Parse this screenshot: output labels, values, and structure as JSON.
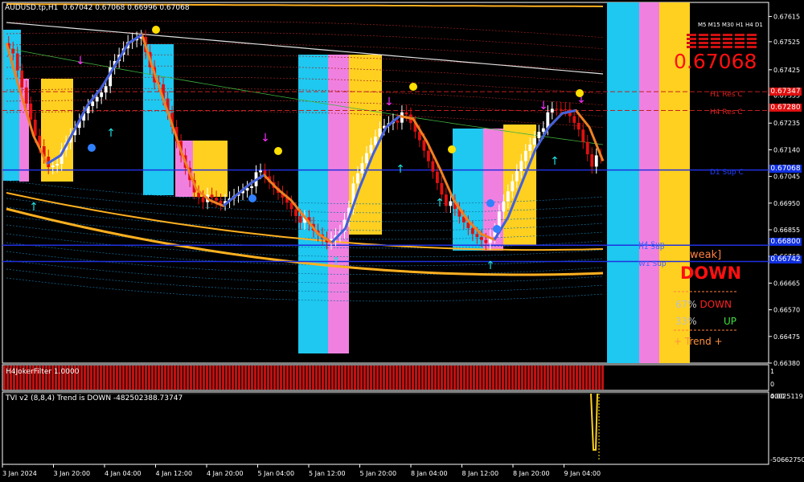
{
  "header": {
    "symbol": "AUDUSD.tp,H1",
    "ohlc": "0.67042 0.67068 0.66996 0.67068"
  },
  "timeframes": [
    "M5",
    "M15",
    "M30",
    "H1",
    "H4",
    "D1"
  ],
  "big_price": "0.67068",
  "levels": {
    "h1_res": "H1 Res C",
    "h4_res": "H4 Res C",
    "d1_sup": "D1 Sup C",
    "h1_sup": "H1 Sup",
    "w1_sup": "W1 Sup",
    "h4_sup_overlap": "H4 Sup"
  },
  "price_tags": [
    "0.67347",
    "0.67280",
    "0.67068",
    "0.66800",
    "0.66742"
  ],
  "panel": {
    "strength": "weak]",
    "signal": "DOWN",
    "down_pct": "67%",
    "down_word": "DOWN",
    "up_pct": "33%",
    "up_word": "UP",
    "trend": "+  Trend  +"
  },
  "indicators": {
    "joker_title": "H4JokerFilter 1.0000",
    "joker_scale": [
      "1",
      "0"
    ],
    "tvi_title": "TVI v2 (8,8,4) Trend is DOWN -482502388.73747",
    "tvi_scale_top": "40025119",
    "tvi_scale_mid": "0.00",
    "tvi_scale_bottom": "-506627502"
  },
  "colors": {
    "bull": "#ffffff",
    "bear": "#e01010",
    "cyan": "#1ec8f0",
    "pink": "#f080e0",
    "yellow": "#ffd020",
    "blue_line": "#4060e0",
    "orange_line": "#f08020",
    "band_orange": "#ffb020"
  },
  "chart_data": {
    "type": "candlestick",
    "symbol": "AUDUSD.tp",
    "timeframe": "H1",
    "y_ticks": [
      "0.67615",
      "0.67525",
      "0.67425",
      "0.67335",
      "0.67235",
      "0.67140",
      "0.67045",
      "0.66950",
      "0.66855",
      "0.66760",
      "0.66665",
      "0.66570",
      "0.66475",
      "0.66380"
    ],
    "x_ticks": [
      "3 Jan 2024",
      "3 Jan 20:00",
      "4 Jan 04:00",
      "4 Jan 12:00",
      "4 Jan 20:00",
      "5 Jan 04:00",
      "5 Jan 12:00",
      "5 Jan 20:00",
      "8 Jan 04:00",
      "8 Jan 12:00",
      "8 Jan 20:00",
      "9 Jan 04:00"
    ],
    "ylim": [
      0.6638,
      0.67665
    ],
    "last_price": 0.67068,
    "resistance": [
      {
        "label": "H1 Res C",
        "value": 0.67347
      },
      {
        "label": "H4 Res C",
        "value": 0.6728
      }
    ],
    "support": [
      {
        "label": "D1 Sup C",
        "value": 0.67068
      },
      {
        "label": "H1 Sup",
        "value": 0.668
      },
      {
        "label": "W1 Sup",
        "value": 0.66742
      }
    ],
    "close_trend": [
      0.6752,
      0.6735,
      0.6719,
      0.6709,
      0.6712,
      0.6721,
      0.673,
      0.6736,
      0.6744,
      0.6752,
      0.6755,
      0.674,
      0.6726,
      0.6712,
      0.67,
      0.6696,
      0.6694,
      0.6698,
      0.6702,
      0.6705,
      0.67,
      0.6696,
      0.669,
      0.6684,
      0.6681,
      0.6686,
      0.67,
      0.6712,
      0.6722,
      0.6726,
      0.6725,
      0.6717,
      0.6707,
      0.6696,
      0.6689,
      0.6684,
      0.6682,
      0.669,
      0.6702,
      0.6714,
      0.6722,
      0.6727,
      0.6728,
      0.6722,
      0.671
    ]
  }
}
